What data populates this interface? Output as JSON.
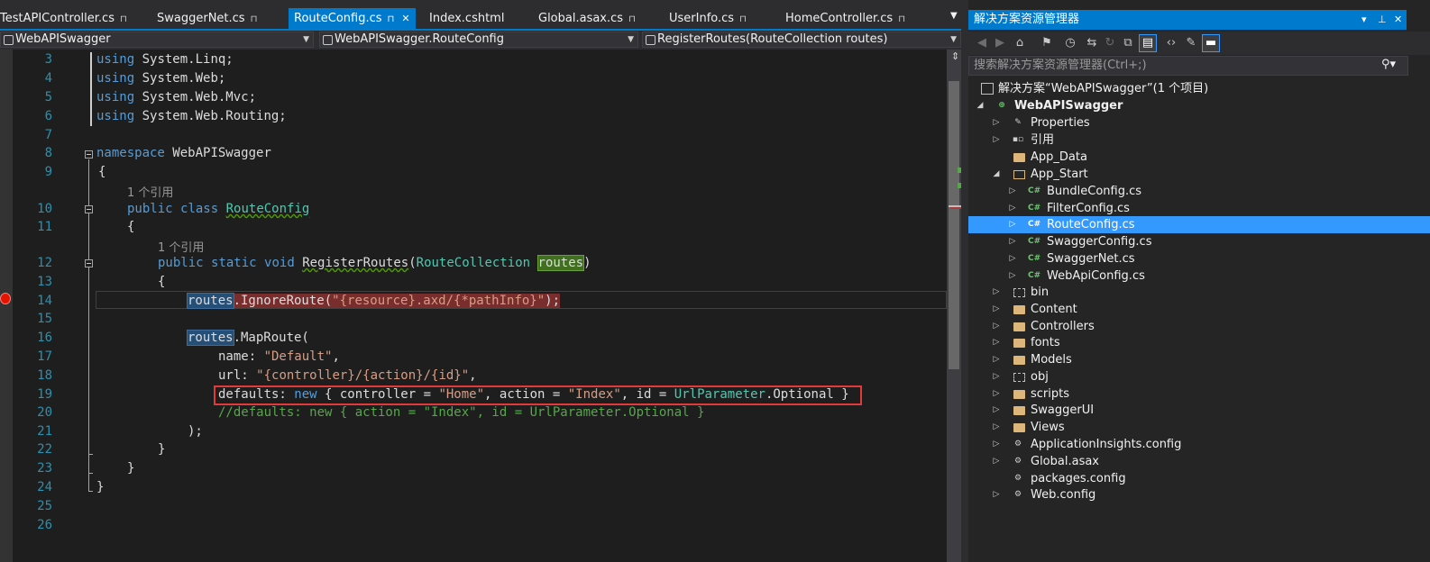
{
  "tabs": [
    {
      "label": "TestAPIController.cs",
      "pinned": true
    },
    {
      "label": "SwaggerNet.cs",
      "pinned": true
    },
    {
      "label": "RouteConfig.cs",
      "pinned": true,
      "active": true
    },
    {
      "label": "Index.cshtml"
    },
    {
      "label": "Global.asax.cs",
      "pinned": true
    },
    {
      "label": "UserInfo.cs",
      "pinned": true
    },
    {
      "label": "HomeController.cs",
      "pinned": true
    }
  ],
  "navbar": {
    "project": "WebAPISwagger",
    "type": "WebAPISwagger.RouteConfig",
    "member": "RegisterRoutes(RouteCollection routes)"
  },
  "editor": {
    "line_numbers": [
      "3",
      "4",
      "5",
      "6",
      "7",
      "8",
      "9",
      "10",
      "11",
      "12",
      "13",
      "14",
      "15",
      "16",
      "17",
      "18",
      "19",
      "20",
      "21",
      "22",
      "23",
      "24",
      "25",
      "26"
    ],
    "codelens": "1 个引用",
    "code": {
      "using": "using",
      "ns_linq": "System.Linq;",
      "ns_web": "System.Web;",
      "ns_mvc": "System.Web.Mvc;",
      "ns_routing": "System.Web.Routing;",
      "namespace_kw": "namespace",
      "namespace_name": "WebAPISwagger",
      "open_brace": "{",
      "close_brace": "}",
      "public": "public",
      "class": "class",
      "class_name": "RouteConfig",
      "static": "static",
      "void": "void",
      "method_name": "RegisterRoutes",
      "param_type": "RouteCollection",
      "param_name": "routes",
      "lparen": "(",
      "rparen": ")",
      "routes_ref": "routes",
      "ignore_call": ".IgnoreRoute(",
      "ignore_arg": "\"{resource}.axd/{*pathInfo}\"",
      "ignore_end": ");",
      "map_call": ".MapRoute(",
      "name_key": "name: ",
      "name_val": "\"Default\"",
      "url_key": "url: ",
      "url_val": "\"{controller}/{action}/{id}\"",
      "comma": ",",
      "defaults_key": "defaults: ",
      "new": "new",
      "defaults_open": " { controller = ",
      "home_val": "\"Home\"",
      "action_part": ", action = ",
      "index_val": "\"Index\"",
      "id_part": ", id = ",
      "urlparam": "UrlParameter",
      "optional_end": ".Optional }",
      "comment_line": "//defaults: new { action = \"Index\", id = UrlParameter.Optional }",
      "close_paren": ");"
    }
  },
  "solution_explorer": {
    "title": "解决方案资源管理器",
    "search_placeholder": "搜索解决方案资源管理器(Ctrl+;)",
    "tree": [
      {
        "label": "解决方案“WebAPISwagger”(1 个项目)",
        "icon": "solution-icon"
      },
      {
        "label": "WebAPISwagger",
        "icon": "web-project-icon"
      },
      {
        "label": "Properties",
        "icon": "wrench-icon"
      },
      {
        "label": "引用",
        "icon": "references-icon"
      },
      {
        "label": "App_Data",
        "icon": "folder-icon"
      },
      {
        "label": "App_Start",
        "icon": "folder-open-icon"
      },
      {
        "label": "BundleConfig.cs",
        "icon": "csharp-file-icon"
      },
      {
        "label": "FilterConfig.cs",
        "icon": "csharp-file-icon"
      },
      {
        "label": "RouteConfig.cs",
        "icon": "csharp-file-icon",
        "selected": true
      },
      {
        "label": "SwaggerConfig.cs",
        "icon": "csharp-file-icon"
      },
      {
        "label": "SwaggerNet.cs",
        "icon": "csharp-file-icon"
      },
      {
        "label": "WebApiConfig.cs",
        "icon": "csharp-file-icon"
      },
      {
        "label": "bin",
        "icon": "excluded-folder-icon"
      },
      {
        "label": "Content",
        "icon": "folder-icon"
      },
      {
        "label": "Controllers",
        "icon": "folder-icon"
      },
      {
        "label": "fonts",
        "icon": "folder-icon"
      },
      {
        "label": "Models",
        "icon": "folder-icon"
      },
      {
        "label": "obj",
        "icon": "excluded-folder-icon"
      },
      {
        "label": "scripts",
        "icon": "folder-icon"
      },
      {
        "label": "SwaggerUI",
        "icon": "folder-icon"
      },
      {
        "label": "Views",
        "icon": "folder-icon"
      },
      {
        "label": "ApplicationInsights.config",
        "icon": "config-file-icon"
      },
      {
        "label": "Global.asax",
        "icon": "global-asax-icon"
      },
      {
        "label": "packages.config",
        "icon": "config-file-icon"
      },
      {
        "label": "Web.config",
        "icon": "config-file-icon"
      }
    ]
  },
  "colors": {
    "accent": "#007acc",
    "selection": "#3399ff",
    "editor_bg": "#1e1e1e",
    "breakpoint": "#e51400",
    "annotation_box": "#e23a3a"
  }
}
